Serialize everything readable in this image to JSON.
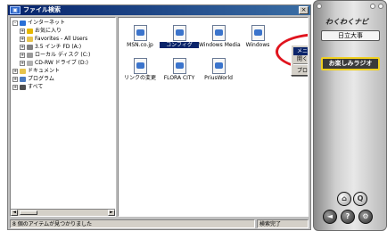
{
  "window": {
    "title": "ファイル検索",
    "close_glyph": "×"
  },
  "tree": {
    "items": [
      {
        "label": "インターネット",
        "exp": "-",
        "icon": "internet-icon",
        "color": "#2a6fd6"
      },
      {
        "label": "お気に入り",
        "exp": "+",
        "icon": "star-folder-icon",
        "color": "#e6b800"
      },
      {
        "label": "Favorites - All Users",
        "exp": "+",
        "icon": "folder-icon",
        "color": "#e6c34d"
      },
      {
        "label": "3.5 インチ FD (A:)",
        "exp": "+",
        "icon": "floppy-icon",
        "color": "#808080"
      },
      {
        "label": "ローカル ディスク (C:)",
        "exp": "+",
        "icon": "hard-disk-icon",
        "color": "#9a9a9a"
      },
      {
        "label": "CD-RW ドライブ (D:)",
        "exp": "+",
        "icon": "cd-drive-icon",
        "color": "#b0b0b0"
      },
      {
        "label": "ドキュメント",
        "exp": "+",
        "icon": "documents-icon",
        "color": "#e6c34d"
      },
      {
        "label": "プログラム",
        "exp": "+",
        "icon": "programs-icon",
        "color": "#4a7ac0"
      },
      {
        "label": "すべて",
        "exp": "+",
        "icon": "all-icon",
        "color": "#505050"
      }
    ],
    "scroll_left": "◄",
    "scroll_right": "►"
  },
  "files": [
    {
      "label": "MSN.co.jp",
      "selected": false
    },
    {
      "label": "コンフィグ",
      "selected": true
    },
    {
      "label": "Windows Media",
      "selected": false
    },
    {
      "label": "Windows",
      "selected": false
    },
    {
      "label": "リンクの変更",
      "selected": false
    },
    {
      "label": "FLORA CITY",
      "selected": false
    },
    {
      "label": "PriusWorld",
      "selected": false
    }
  ],
  "context_menu": {
    "items": [
      "メニューに追加(A)...",
      "開く(O)",
      "プロパティ(R)"
    ]
  },
  "status": {
    "left": "8 個のアイテムが見つかりました",
    "right": "検索完了"
  },
  "panel": {
    "logo": "わくわくナビ",
    "brand": "日立大事",
    "radio": "お楽しみラジオ",
    "btn_home": "⌂",
    "btn_search": "Q",
    "btn_back": "◄",
    "btn_help": "?",
    "btn_settings": "⚙"
  },
  "colors": {
    "title_gradient_start": "#06236b",
    "selection": "#0a246a",
    "highlight_ring": "#e0141e",
    "radio_border": "#f0d020"
  }
}
